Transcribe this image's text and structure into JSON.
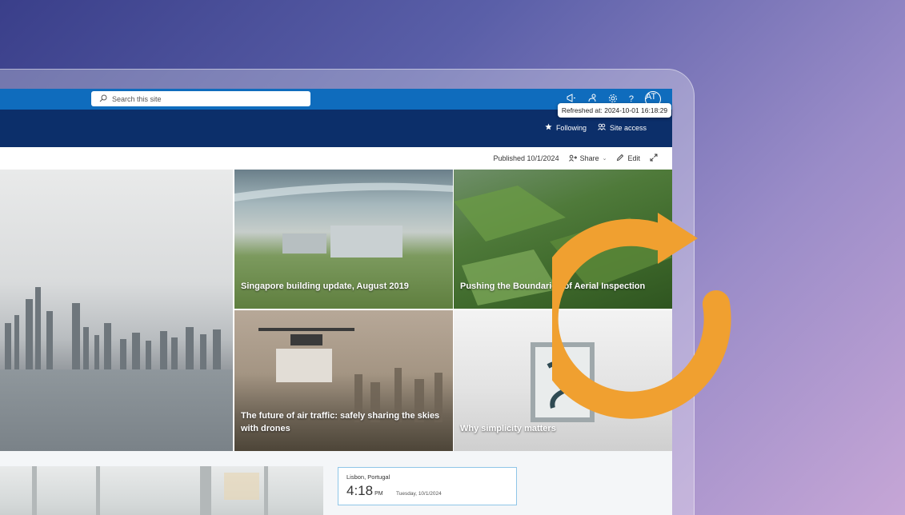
{
  "suitebar": {
    "search_placeholder": "Search this site",
    "avatar_initials": "AT",
    "help_label": "?",
    "tooltip": "Refreshed at: 2024-10-01 16:18:29"
  },
  "sitebar": {
    "following_label": "Following",
    "site_access_label": "Site access"
  },
  "command_bar": {
    "published": "Published 10/1/2024",
    "share_label": "Share",
    "edit_label": "Edit"
  },
  "hero": {
    "tiles": [
      {
        "caption": "Singapore building update, August 2019"
      },
      {
        "caption": "Pushing the Boundaries of Aerial Inspection"
      },
      {
        "caption": "The future of air traffic: safely sharing the skies with drones"
      },
      {
        "caption": "Why simplicity matters"
      }
    ]
  },
  "clock": {
    "location": "Lisbon, Portugal",
    "time": "4:18",
    "ampm": "PM",
    "date": "Tuesday, 10/1/2024"
  },
  "colors": {
    "suitebar": "#0f6cbd",
    "sitebar": "#0c2f6a",
    "refresh_accent": "#f0a030"
  }
}
